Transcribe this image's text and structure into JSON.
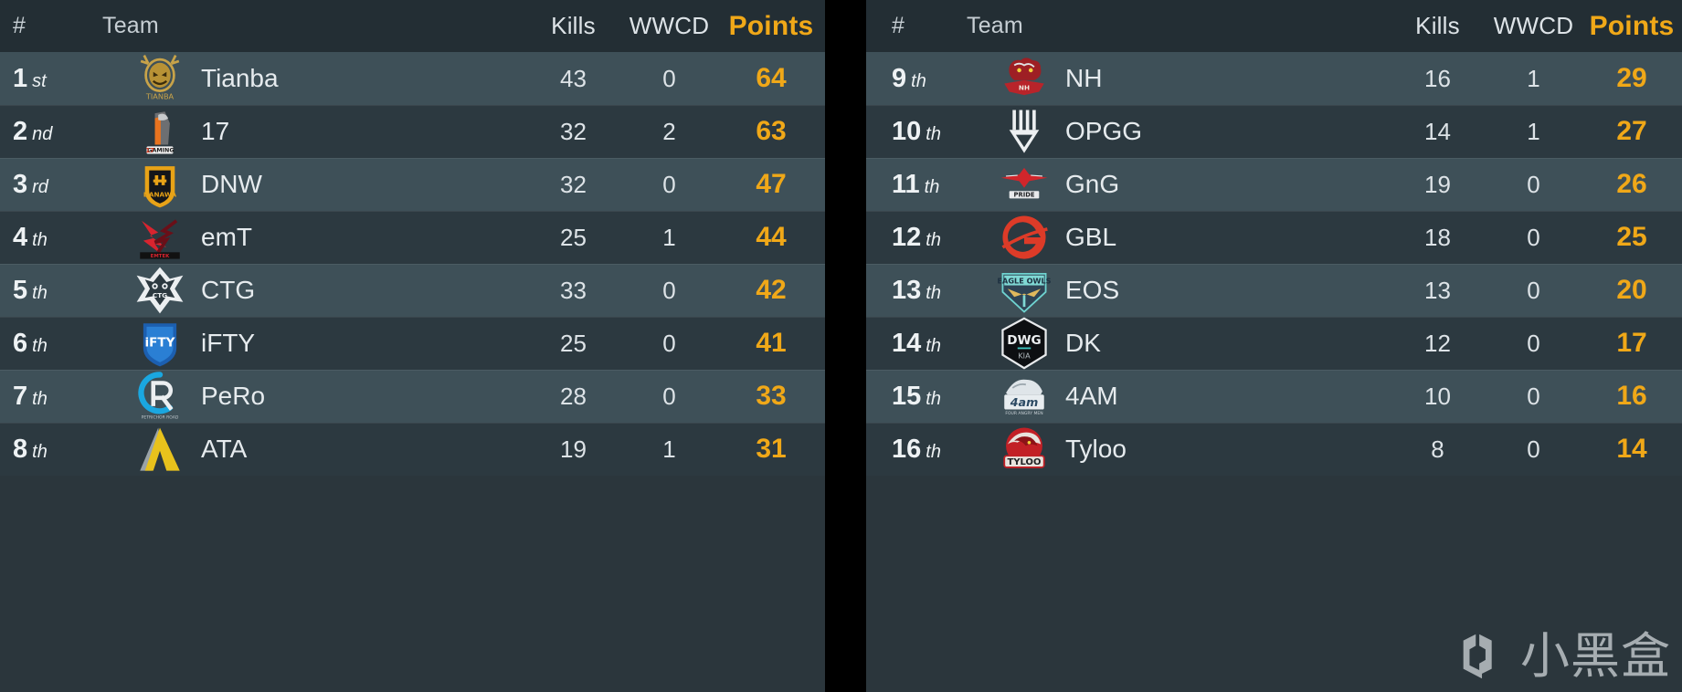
{
  "columns": {
    "rank": "#",
    "team": "Team",
    "kills": "Kills",
    "wwcd": "WWCD",
    "points": "Points"
  },
  "colors": {
    "points": "#f0a818",
    "row_odd": "#3e5058",
    "row_even": "#2c3940",
    "header_bg": "#232e34",
    "gap": "#000000"
  },
  "watermark": {
    "text": "小黑盒",
    "logo": "hei-box-logo-icon"
  },
  "left": {
    "rows": [
      {
        "rank": "1",
        "suffix": "st",
        "team": "Tianba",
        "logo": "tianba-logo",
        "kills": "43",
        "wwcd": "0",
        "points": "64"
      },
      {
        "rank": "2",
        "suffix": "nd",
        "team": "17",
        "logo": "17gaming-logo",
        "kills": "32",
        "wwcd": "2",
        "points": "63"
      },
      {
        "rank": "3",
        "suffix": "rd",
        "team": "DNW",
        "logo": "danawa-logo",
        "kills": "32",
        "wwcd": "0",
        "points": "47"
      },
      {
        "rank": "4",
        "suffix": "th",
        "team": "emT",
        "logo": "emt-logo",
        "kills": "25",
        "wwcd": "1",
        "points": "44"
      },
      {
        "rank": "5",
        "suffix": "th",
        "team": "CTG",
        "logo": "ctg-logo",
        "kills": "33",
        "wwcd": "0",
        "points": "42"
      },
      {
        "rank": "6",
        "suffix": "th",
        "team": "iFTY",
        "logo": "ifty-logo",
        "kills": "25",
        "wwcd": "0",
        "points": "41"
      },
      {
        "rank": "7",
        "suffix": "th",
        "team": "PeRo",
        "logo": "pero-logo",
        "kills": "28",
        "wwcd": "0",
        "points": "33"
      },
      {
        "rank": "8",
        "suffix": "th",
        "team": "ATA",
        "logo": "ata-logo",
        "kills": "19",
        "wwcd": "1",
        "points": "31"
      }
    ]
  },
  "right": {
    "rows": [
      {
        "rank": "9",
        "suffix": "th",
        "team": "NH",
        "logo": "nh-esports-logo",
        "kills": "16",
        "wwcd": "1",
        "points": "29"
      },
      {
        "rank": "10",
        "suffix": "th",
        "team": "OPGG",
        "logo": "opgg-logo",
        "kills": "14",
        "wwcd": "1",
        "points": "27"
      },
      {
        "rank": "11",
        "suffix": "th",
        "team": "GnG",
        "logo": "gng-pride-logo",
        "kills": "19",
        "wwcd": "0",
        "points": "26"
      },
      {
        "rank": "12",
        "suffix": "th",
        "team": "GBL",
        "logo": "gbl-logo",
        "kills": "18",
        "wwcd": "0",
        "points": "25"
      },
      {
        "rank": "13",
        "suffix": "th",
        "team": "EOS",
        "logo": "eagle-owls-logo",
        "kills": "13",
        "wwcd": "0",
        "points": "20"
      },
      {
        "rank": "14",
        "suffix": "th",
        "team": "DK",
        "logo": "dwg-kia-logo",
        "kills": "12",
        "wwcd": "0",
        "points": "17"
      },
      {
        "rank": "15",
        "suffix": "th",
        "team": "4AM",
        "logo": "4am-logo",
        "kills": "10",
        "wwcd": "0",
        "points": "16"
      },
      {
        "rank": "16",
        "suffix": "th",
        "team": "Tyloo",
        "logo": "tyloo-logo",
        "kills": "8",
        "wwcd": "0",
        "points": "14"
      }
    ]
  }
}
